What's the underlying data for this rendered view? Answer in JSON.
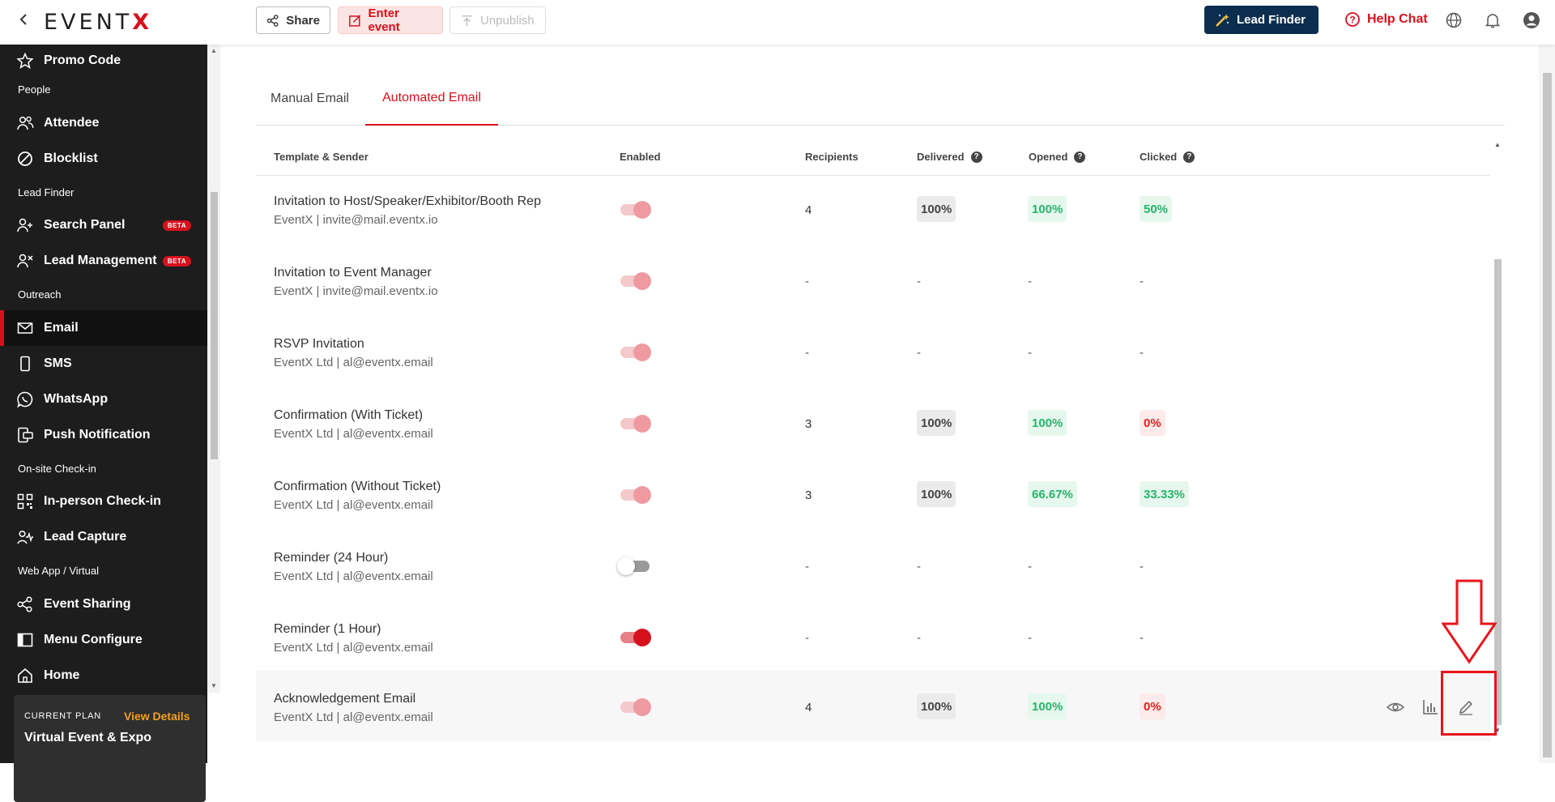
{
  "topbar": {
    "logo_prefix": "EVENT",
    "logo_x": "X",
    "share": "Share",
    "enter_event": "Enter event",
    "unpublish": "Unpublish",
    "lead_finder": "Lead Finder",
    "help_chat": "Help Chat"
  },
  "sidebar": {
    "items": [
      {
        "label": "Promo Code"
      },
      {
        "section": "People"
      },
      {
        "label": "Attendee"
      },
      {
        "label": "Blocklist"
      },
      {
        "section": "Lead Finder"
      },
      {
        "label": "Search Panel",
        "badge": "BETA"
      },
      {
        "label": "Lead Management",
        "badge": "BETA"
      },
      {
        "section": "Outreach"
      },
      {
        "label": "Email"
      },
      {
        "label": "SMS"
      },
      {
        "label": "WhatsApp"
      },
      {
        "label": "Push Notification"
      },
      {
        "section": "On-site Check-in"
      },
      {
        "label": "In-person Check-in"
      },
      {
        "label": "Lead Capture"
      },
      {
        "section": "Web App / Virtual"
      },
      {
        "label": "Event Sharing"
      },
      {
        "label": "Menu Configure"
      },
      {
        "label": "Home"
      }
    ],
    "plan": {
      "label": "CURRENT PLAN",
      "link": "View Details",
      "name": "Virtual Event & Expo"
    }
  },
  "tabs": [
    "Manual Email",
    "Automated Email"
  ],
  "table": {
    "headers": [
      "Template & Sender",
      "Enabled",
      "Recipients",
      "Delivered",
      "Opened",
      "Clicked"
    ],
    "help_glyph": "?",
    "rows": [
      {
        "name": "Invitation to Host/Speaker/Exhibitor/Booth Rep",
        "sender": "EventX | invite@mail.eventx.io",
        "enabled": "on",
        "recipients": "4",
        "delivered": "100%",
        "opened": "100%",
        "clicked": "50%"
      },
      {
        "name": "Invitation to Event Manager",
        "sender": "EventX | invite@mail.eventx.io",
        "enabled": "on",
        "recipients": "-",
        "delivered": "-",
        "opened": "-",
        "clicked": "-"
      },
      {
        "name": "RSVP Invitation",
        "sender": "EventX Ltd | al@eventx.email",
        "enabled": "on",
        "recipients": "-",
        "delivered": "-",
        "opened": "-",
        "clicked": "-"
      },
      {
        "name": "Confirmation (With Ticket)",
        "sender": "EventX Ltd | al@eventx.email",
        "enabled": "on",
        "recipients": "3",
        "delivered": "100%",
        "opened": "100%",
        "clicked": "0%"
      },
      {
        "name": "Confirmation (Without Ticket)",
        "sender": "EventX Ltd | al@eventx.email",
        "enabled": "on",
        "recipients": "3",
        "delivered": "100%",
        "opened": "66.67%",
        "clicked": "33.33%"
      },
      {
        "name": "Reminder (24 Hour)",
        "sender": "EventX Ltd | al@eventx.email",
        "enabled": "off",
        "recipients": "-",
        "delivered": "-",
        "opened": "-",
        "clicked": "-"
      },
      {
        "name": "Reminder (1 Hour)",
        "sender": "EventX Ltd | al@eventx.email",
        "enabled": "on-strong",
        "recipients": "-",
        "delivered": "-",
        "opened": "-",
        "clicked": "-"
      },
      {
        "name": "Acknowledgement Email",
        "sender": "EventX Ltd | al@eventx.email",
        "enabled": "on",
        "recipients": "4",
        "delivered": "100%",
        "opened": "100%",
        "clicked": "0%"
      }
    ]
  }
}
